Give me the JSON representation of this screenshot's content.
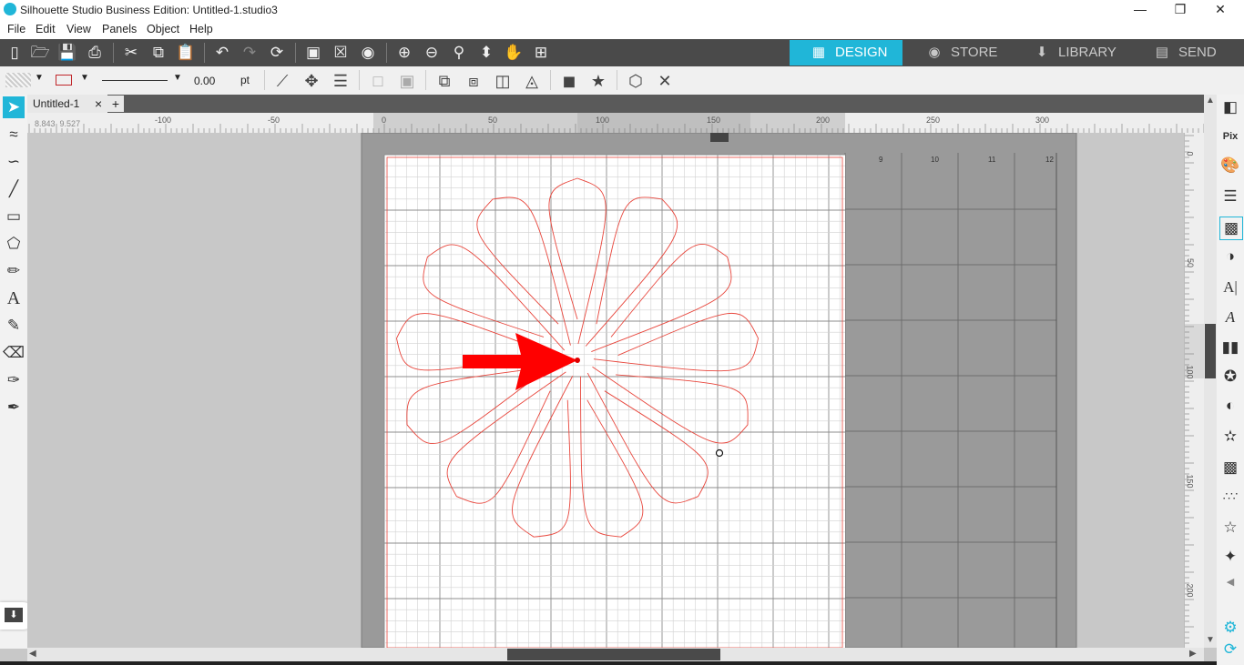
{
  "window": {
    "title": "Silhouette Studio Business Edition: Untitled-1.studio3",
    "minimize": "—",
    "restore": "❒",
    "close": "✕"
  },
  "menu": {
    "file": "File",
    "edit": "Edit",
    "view": "View",
    "panels": "Panels",
    "object": "Object",
    "help": "Help"
  },
  "nav_tabs": {
    "design": "DESIGN",
    "store": "STORE",
    "library": "LIBRARY",
    "send": "SEND"
  },
  "line_style": {
    "width_value": "0.00",
    "unit": "pt"
  },
  "document": {
    "tab_label": "Untitled-1",
    "tab_close": "×",
    "add_tab": "+"
  },
  "coordinates": {
    "x": "8.843",
    "y": "9.527"
  },
  "rulers": {
    "horizontal_labels": [
      "-100",
      "-50",
      "0",
      "50",
      "100",
      "150",
      "200",
      "250",
      "300"
    ],
    "vertical_labels": [
      "0",
      "50",
      "100",
      "150",
      "200"
    ],
    "mat_labels": [
      "9",
      "10",
      "11",
      "12"
    ]
  },
  "colors": {
    "accent": "#20b6d8",
    "toolbar_dark": "#4a4a4a",
    "cut_line": "#e8463c",
    "arrow": "#ff0000",
    "grid": "#c9c9c9",
    "mat": "#9a9a9a"
  },
  "icons": {
    "left_tools": [
      "select-pointer-icon",
      "point-edit-icon",
      "curve-icon",
      "line-tool-icon",
      "rectangle-tool-icon",
      "polygon-tool-icon",
      "pencil-icon",
      "text-tool-icon",
      "sketch-icon",
      "eraser-icon",
      "knife-icon",
      "eyedropper-icon"
    ],
    "right_panels": [
      "page-setup-icon",
      "pixscan-icon",
      "fill-color-icon",
      "line-style-icon",
      "fill-pattern-icon",
      "gradient-icon",
      "text-style-icon",
      "text-to-path-icon",
      "align-icon",
      "replicate-icon",
      "modify-icon",
      "offset-icon",
      "trace-icon",
      "rhinestone-icon",
      "star-icon",
      "puzzle-icon",
      "settings-gear-icon",
      "sync-icon"
    ]
  }
}
